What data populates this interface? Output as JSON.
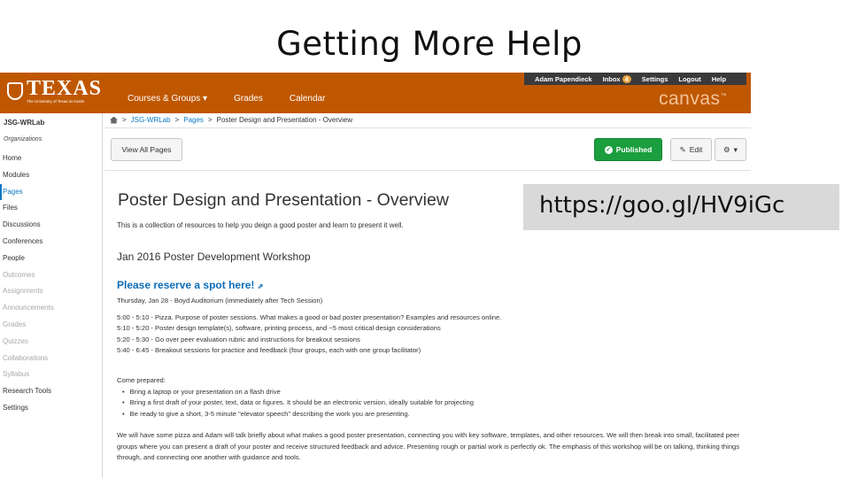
{
  "slide": {
    "title": "Getting More Help"
  },
  "header": {
    "logo_text": "TEXAS",
    "logo_sub": "The University of Texas at Austin",
    "nav": [
      "Courses & Groups ▾",
      "Grades",
      "Calendar"
    ],
    "user": "Adam Papendieck",
    "inbox": "Inbox",
    "inbox_count": "4",
    "settings": "Settings",
    "logout": "Logout",
    "help": "Help",
    "brand": "canvas",
    "brand_tm": "™"
  },
  "sidebar": {
    "course": "JSG-WRLab",
    "section_label": "Organizations",
    "items": [
      {
        "label": "Home"
      },
      {
        "label": "Modules"
      },
      {
        "label": "Pages"
      },
      {
        "label": "Files"
      },
      {
        "label": "Discussions"
      },
      {
        "label": "Conferences"
      },
      {
        "label": "People"
      },
      {
        "label": "Outcomes"
      },
      {
        "label": "Assignments"
      },
      {
        "label": "Announcements"
      },
      {
        "label": "Grades"
      },
      {
        "label": "Quizzes"
      },
      {
        "label": "Collaborations"
      },
      {
        "label": "Syllabus"
      },
      {
        "label": "Research Tools"
      },
      {
        "label": "Settings"
      }
    ]
  },
  "breadcrumb": {
    "sep": ">",
    "course": "JSG-WRLab",
    "pages": "Pages",
    "current": "Poster Design and Presentation - Overview"
  },
  "toolbar": {
    "view_all": "View All Pages",
    "published": "Published",
    "edit": "Edit",
    "gear_caret": "▾"
  },
  "content": {
    "heading": "Poster Design and Presentation - Overview",
    "intro": "This is a collection of resources to help you deign a good poster and learn to present it well.",
    "workshop_title": "Jan 2016 Poster Development Workshop",
    "reserve_link": "Please reserve a spot here!",
    "date_line": "Thursday, Jan 28 - Boyd Auditorium (immediately after Tech Session)",
    "schedule": [
      "5:00 - 5:10 - Pizza. Purpose of poster sessions. What makes a good or bad poster presentation? Examples and resources online.",
      "5:10 - 5:20 - Poster design template(s), software, printing process, and ~5 most critical design considerations",
      "5:20 - 5:30 - Go over peer evaluation rubric and instructions for breakout sessions",
      "5:40 - 6:45 - Breakout sessions for practice and feedback (four groups, each with one group facilitator)"
    ],
    "come_label": "Come prepared:",
    "prep": [
      "Bring a laptop or your presentation on a flash drive",
      "Bring a first draft of your poster, text, data or figures. It should be an electronic version, ideally suitable for projecting",
      "Be ready to give a short, 3-5 minute \"elevator speech\" describing the work you are presenting."
    ],
    "closing": "We will have some pizza and Adam will talk briefly about what makes a good poster presentation, connecting you with key software, templates, and other resources. We will then break into small, facilitated peer groups where you can present a draft of your poster and receive structured feedback and advice. Presenting rough or partial work is perfectly ok. The emphasis of this workshop will be on talking, thinking things through, and connecting one another with guidance and tools."
  },
  "callout": {
    "url": "https://goo.gl/HV9iGc"
  },
  "colors": {
    "burnt_orange": "#bf5700",
    "published_green": "#1b9e3e",
    "link_blue": "#0c78c2"
  }
}
